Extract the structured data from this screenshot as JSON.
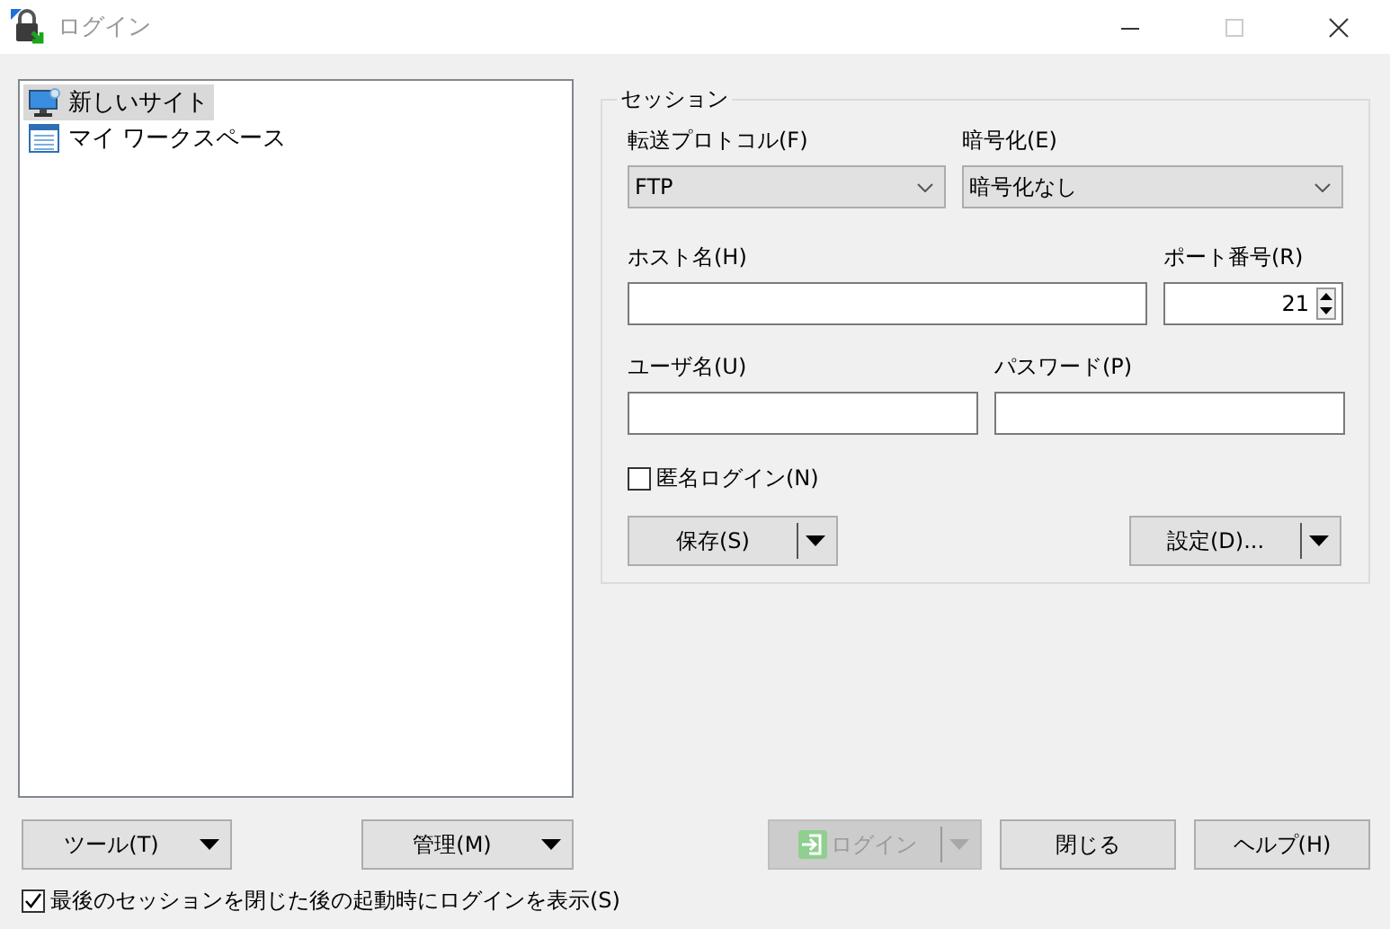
{
  "window": {
    "title": "ログイン",
    "controls": [
      {
        "kind": "minimize",
        "disabled": false
      },
      {
        "kind": "maximize",
        "disabled": true
      },
      {
        "kind": "close",
        "disabled": false
      }
    ]
  },
  "sites": [
    {
      "kind": "site",
      "label": "新しいサイト",
      "selected": true
    },
    {
      "kind": "workspace",
      "label": "マイ ワークスペース",
      "selected": false
    }
  ],
  "session": {
    "legend": "セッション",
    "protocol": {
      "label": "転送プロトコル(F)",
      "value": "FTP"
    },
    "encryption": {
      "label": "暗号化(E)",
      "value": "暗号化なし"
    },
    "host": {
      "label": "ホスト名(H)"
    },
    "port": {
      "label": "ポート番号(R)",
      "value": "21"
    },
    "user": {
      "label": "ユーザ名(U)"
    },
    "password": {
      "label": "パスワード(P)"
    },
    "anonymous": {
      "label": "匿名ログイン(N)",
      "checked": false
    },
    "save_button": "保存(S)",
    "advanced_button": "設定(D)..."
  },
  "tools_button": "ツール(T)",
  "manage_button": "管理(M)",
  "login_button": {
    "label": "ログイン",
    "disabled": true
  },
  "close_button": "閉じる",
  "help_button": "ヘルプ(H)",
  "show_on_startup": {
    "label": "最後のセッションを閉じた後の起動時にログインを表示(S)",
    "checked": true
  }
}
